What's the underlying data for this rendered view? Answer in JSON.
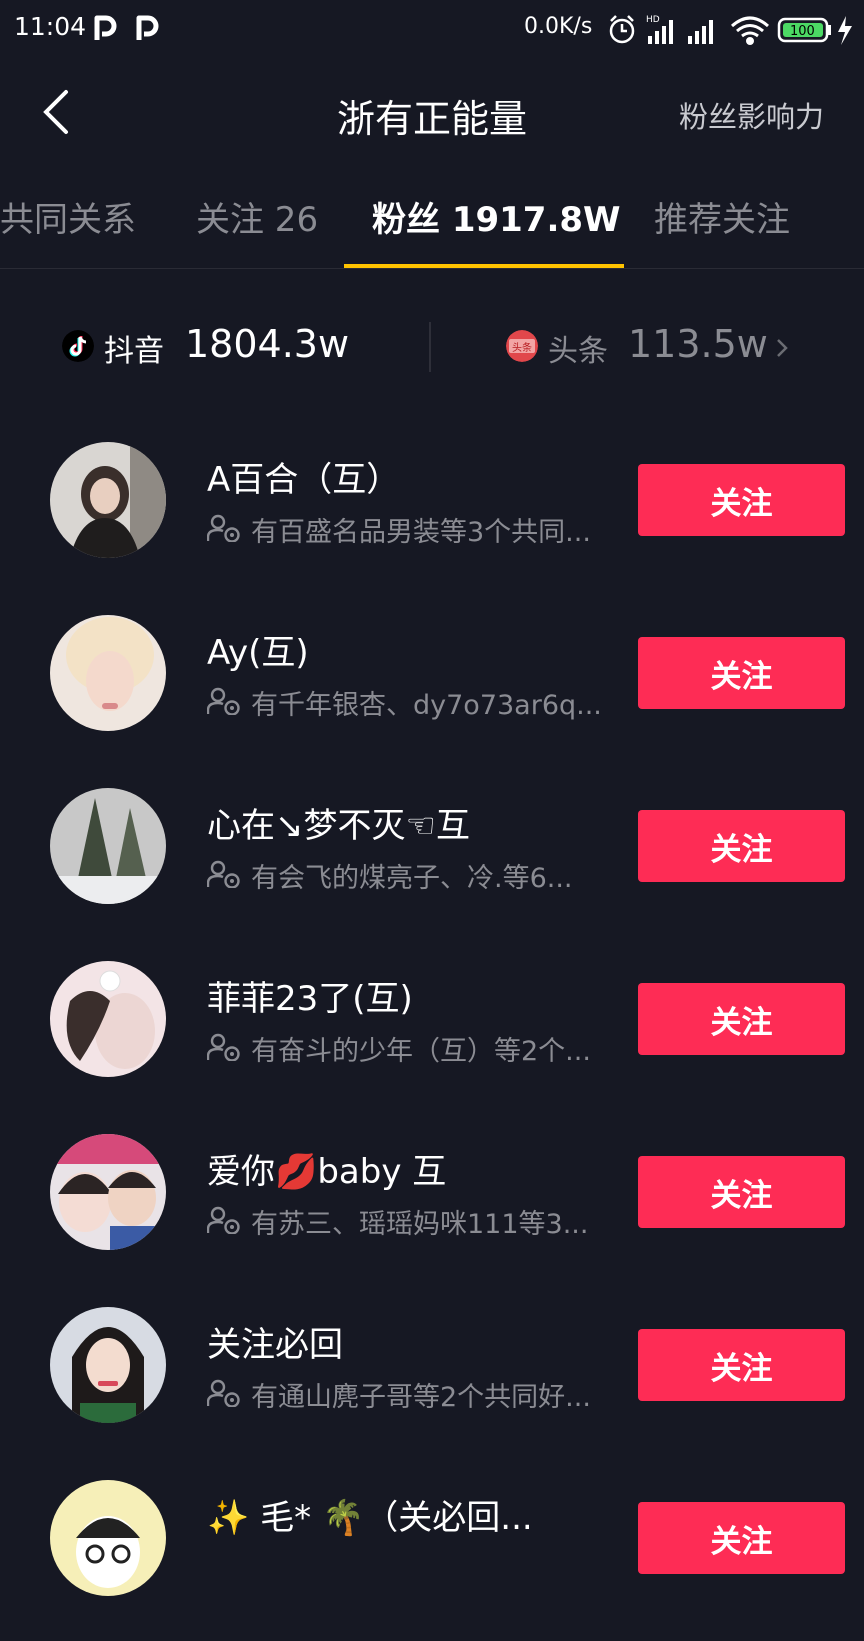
{
  "status": {
    "time": "11:04",
    "net_speed": "0.0K/s",
    "battery": "100"
  },
  "header": {
    "title": "浙有正能量",
    "influence_link": "粉丝影响力"
  },
  "tabs": [
    {
      "label": "共同关系"
    },
    {
      "label": "关注 26"
    },
    {
      "label": "粉丝 1917.8W"
    },
    {
      "label": "推荐关注"
    }
  ],
  "platforms": {
    "douyin": {
      "label": "抖音",
      "value": "1804.3w"
    },
    "toutiao": {
      "label": "头条",
      "value": "113.5w",
      "icon_text": "头条"
    }
  },
  "follow_label": "关注",
  "users": [
    {
      "name": "A百合（互）",
      "mutual": "有百盛名品男装等3个共同..."
    },
    {
      "name": "Ay(互)",
      "mutual": "有千年银杏、dy7o73ar6q..."
    },
    {
      "name": "心在↘梦不灭☜互",
      "mutual": "有会飞的煤亮子、冷.等6..."
    },
    {
      "name": "菲菲23了(互)",
      "mutual": "有奋斗的少年（互）等2个..."
    },
    {
      "name": "爱你💋baby  互",
      "mutual": "有苏三、瑶瑶妈咪111等3..."
    },
    {
      "name": "关注必回",
      "mutual": "有通山麂子哥等2个共同好..."
    },
    {
      "name": "✨  毛*  🌴（关必回...",
      "mutual": ""
    }
  ],
  "colors": {
    "background": "#161823",
    "accent_button": "#fe2c55",
    "tab_indicator": "#ffc300",
    "muted_text": "#8b8c93"
  },
  "icons": [
    "back-arrow-icon",
    "douyin-logo-icon",
    "toutiao-logo-icon",
    "chevron-right-icon",
    "mutual-friends-icon"
  ]
}
